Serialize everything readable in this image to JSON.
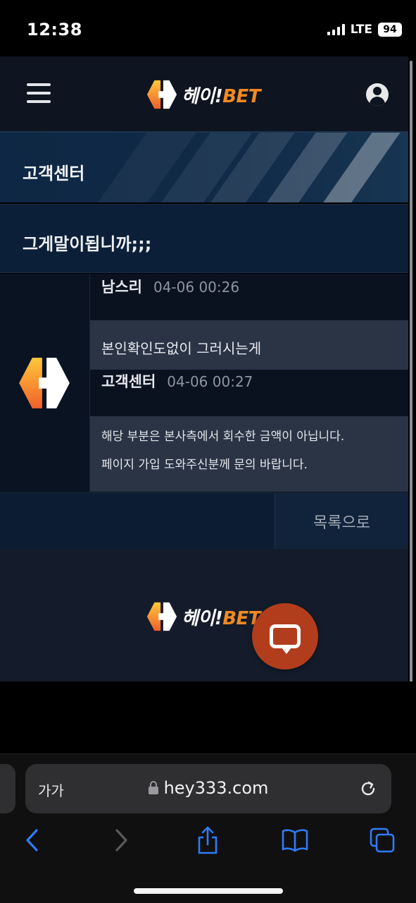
{
  "status_bar": {
    "time": "12:38",
    "network": "LTE",
    "battery": "94"
  },
  "header": {
    "logo": {
      "korean": "헤이!",
      "latin": "BET"
    },
    "menu_icon": "hamburger-menu-icon",
    "user_icon": "user-profile-icon"
  },
  "banner": {
    "title": "고객센터"
  },
  "post": {
    "title": "그게말이됩니까;;;",
    "messages": [
      {
        "author": "남스리",
        "timestamp": "04-06 00:26",
        "text": "본인확인도없이 그러시는게"
      },
      {
        "author": "고객센터",
        "timestamp": "04-06 00:27",
        "lines": [
          "해당 부분은 본사측에서 회수한 금액이 아닙니다.",
          "페이지 가입 도와주신분께 문의 바랍니다."
        ]
      }
    ]
  },
  "actions": {
    "list_button": "목록으로"
  },
  "footer": {
    "logo": {
      "korean": "헤이!",
      "latin": "BET"
    }
  },
  "chat_button": {
    "icon": "chat-bubble-icon"
  },
  "browser": {
    "text_size_label": "가가",
    "url": "hey333.com",
    "toolbar": [
      "back",
      "forward",
      "share",
      "bookmarks",
      "tabs"
    ]
  },
  "colors": {
    "accent": "#f28a21",
    "chat_button": "#b13d1c",
    "header_bg": "#0e1420",
    "ios_blue": "#2f7cf6"
  }
}
